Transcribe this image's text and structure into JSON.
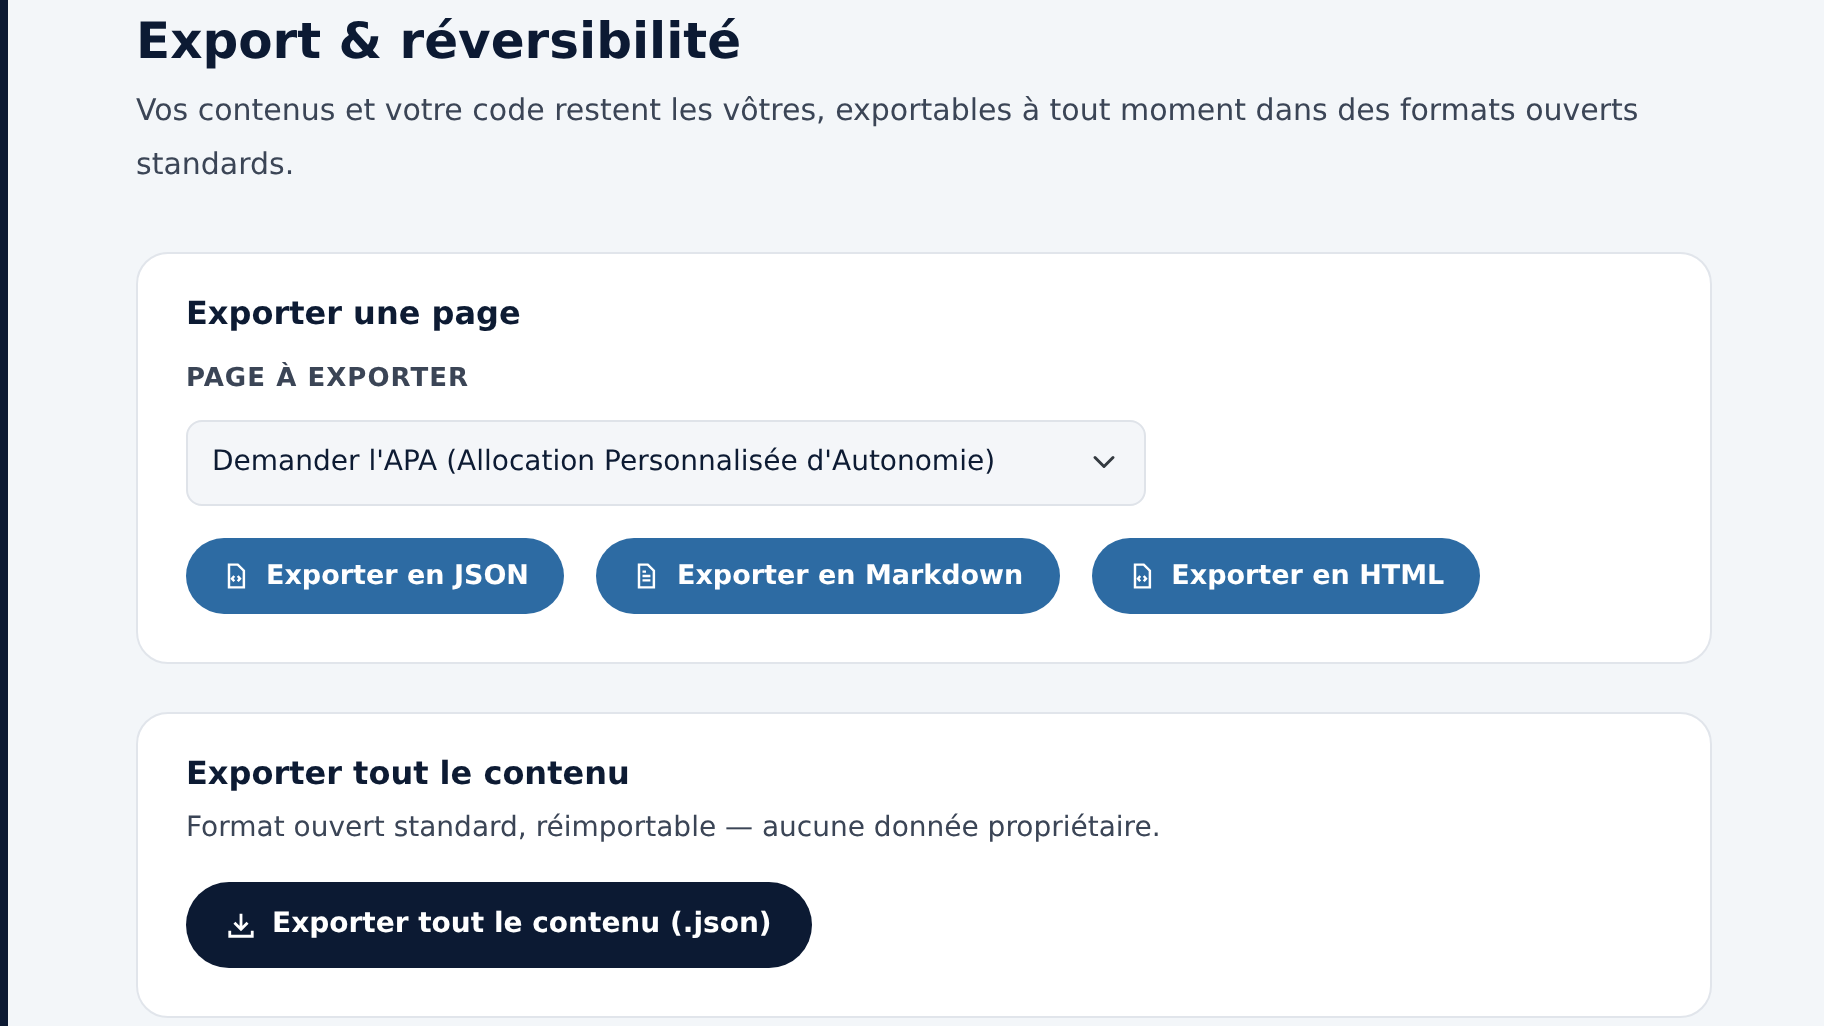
{
  "header": {
    "title": "Export & réversibilité",
    "description": "Vos contenus et votre code restent les vôtres, exportables à tout moment dans des formats ouverts standards."
  },
  "sections": [
    {
      "title": "Exporter une page",
      "field": {
        "label": "PAGE À EXPORTER",
        "value": "Demander l'APA (Allocation Personnalisée d'Autonomie)"
      },
      "buttons": [
        {
          "label": "Exporter en JSON",
          "kind": "code"
        },
        {
          "label": "Exporter en Markdown",
          "kind": "text"
        },
        {
          "label": "Exporter en HTML",
          "kind": "code"
        }
      ]
    },
    {
      "title": "Exporter tout le contenu",
      "description": "Format ouvert standard, réimportable — aucune donnée propriétaire.",
      "buttons": [
        {
          "label": "Exporter tout le contenu (.json)",
          "kind": "download"
        }
      ]
    }
  ]
}
